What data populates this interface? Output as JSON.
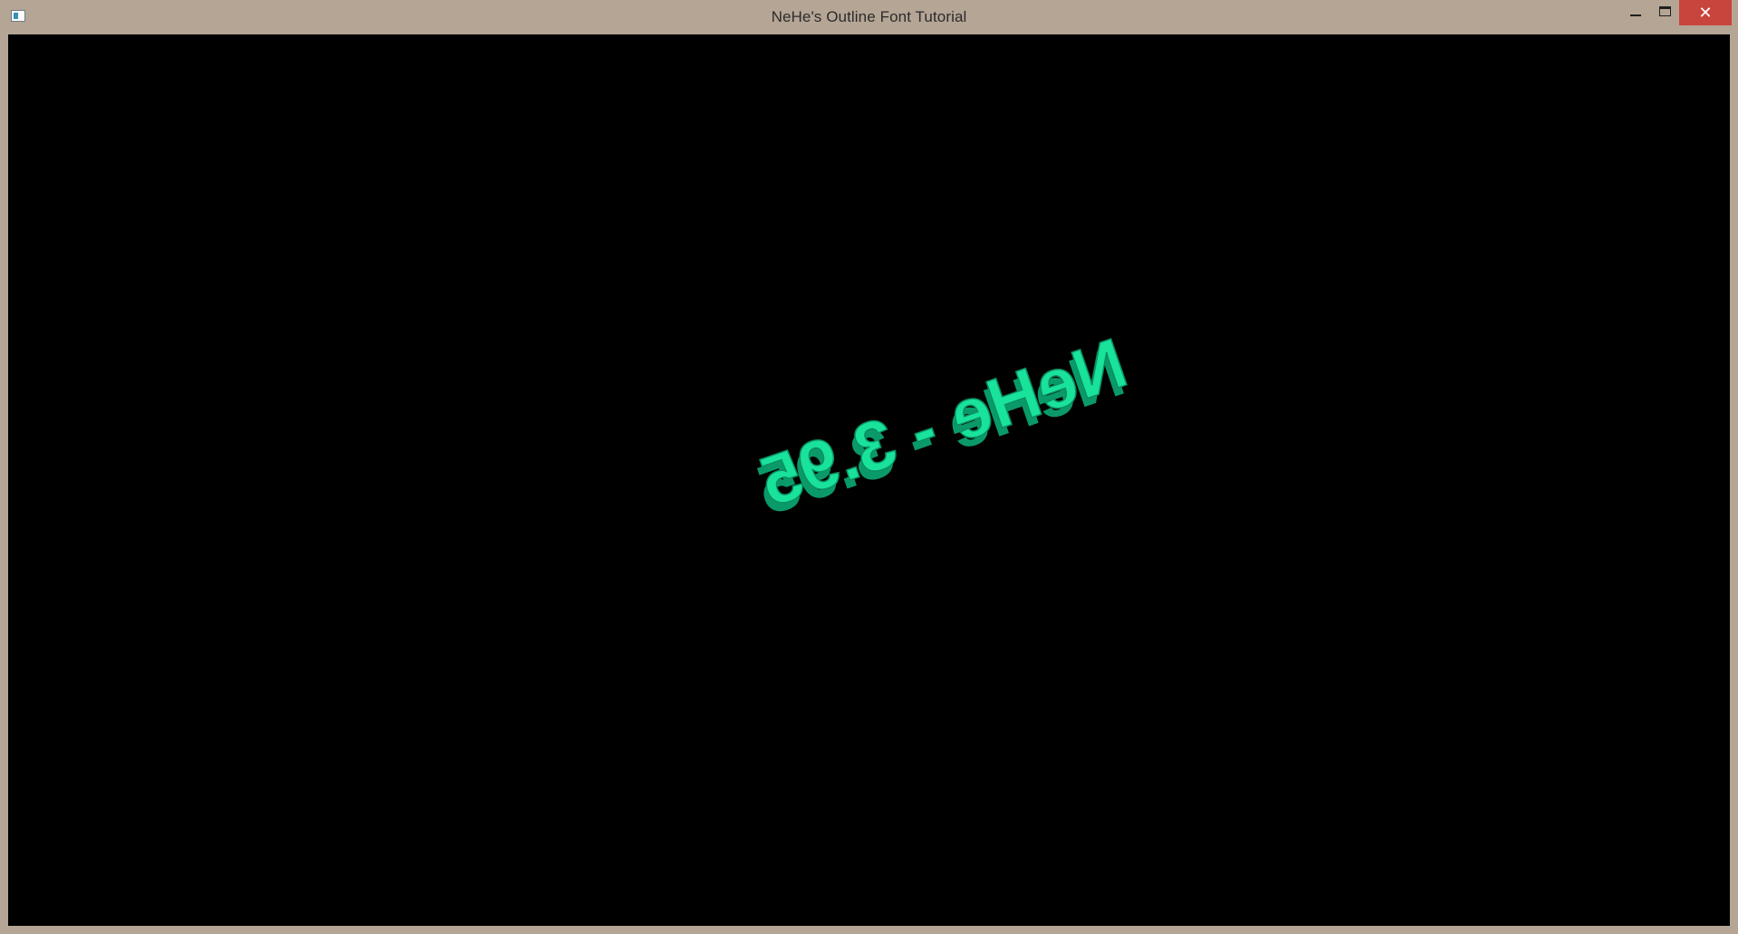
{
  "window": {
    "title": "NeHe's Outline Font Tutorial",
    "controls": {
      "minimize": "minimize-icon",
      "maximize": "maximize-icon",
      "close_symbol": "✕"
    },
    "colors": {
      "frame": "#b5a595",
      "close_button": "#c7453c",
      "client_background": "#000000"
    }
  },
  "scene": {
    "rendered_text": "NeHe - 3.95",
    "text_color": "#19e29b"
  }
}
